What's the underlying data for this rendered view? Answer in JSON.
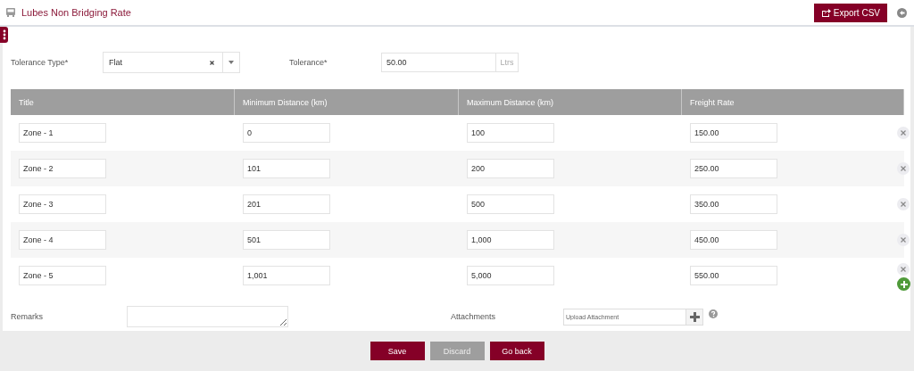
{
  "header": {
    "title": "Lubes Non Bridging Rate",
    "export_button": "Export CSV"
  },
  "form": {
    "tolerance_type": {
      "label": "Tolerance Type*",
      "value": "Flat"
    },
    "tolerance": {
      "label": "Tolerance*",
      "value": "50.00",
      "unit": "Ltrs"
    }
  },
  "table": {
    "columns": [
      "Title",
      "Minimum Distance (km)",
      "Maximum Distance (km)",
      "Freight Rate"
    ],
    "rows": [
      {
        "cells": [
          "Zone - 1",
          "0",
          "100",
          "150.00"
        ]
      },
      {
        "cells": [
          "Zone - 2",
          "101",
          "200",
          "250.00"
        ]
      },
      {
        "cells": [
          "Zone - 3",
          "201",
          "500",
          "350.00"
        ]
      },
      {
        "cells": [
          "Zone - 4",
          "501",
          "1,000",
          "450.00"
        ]
      },
      {
        "cells": [
          "Zone - 5",
          "1,001",
          "5,000",
          "550.00"
        ]
      }
    ]
  },
  "remarks": {
    "label": "Remarks"
  },
  "attachments": {
    "label": "Attachments",
    "placeholder": "Upload Attachment"
  },
  "buttons": [
    {
      "label": "Save",
      "disabled": false
    },
    {
      "label": "Discard",
      "disabled": true
    },
    {
      "label": "Go back",
      "disabled": false
    }
  ]
}
